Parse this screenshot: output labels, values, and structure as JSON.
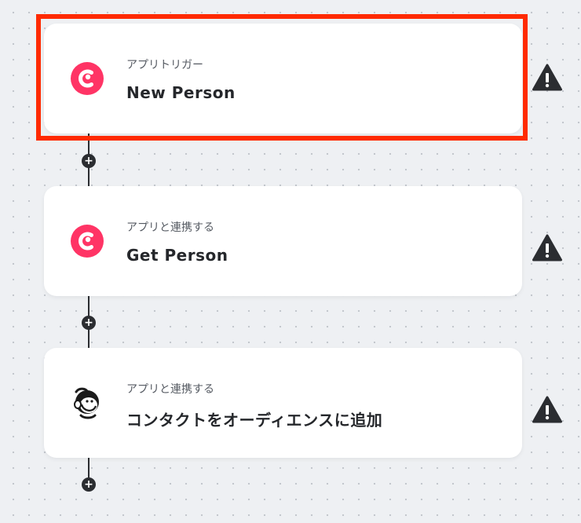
{
  "steps": [
    {
      "subtitle": "アプリトリガー",
      "title": "New Person",
      "app_icon": "copper-crm-icon",
      "selected": true,
      "warning_icon": "warning-icon"
    },
    {
      "subtitle": "アプリと連携する",
      "title": "Get Person",
      "app_icon": "copper-crm-icon",
      "selected": false,
      "warning_icon": "warning-icon"
    },
    {
      "subtitle": "アプリと連携する",
      "title": "コンタクトをオーディエンスに追加",
      "app_icon": "mailchimp-icon",
      "selected": false,
      "warning_icon": "warning-icon"
    }
  ],
  "add_step_symbol": "+",
  "colors": {
    "copper_brand": "#ff3465",
    "selection_border": "#ff2a00",
    "warning": "#2b2d31",
    "background": "#eef0f3"
  }
}
